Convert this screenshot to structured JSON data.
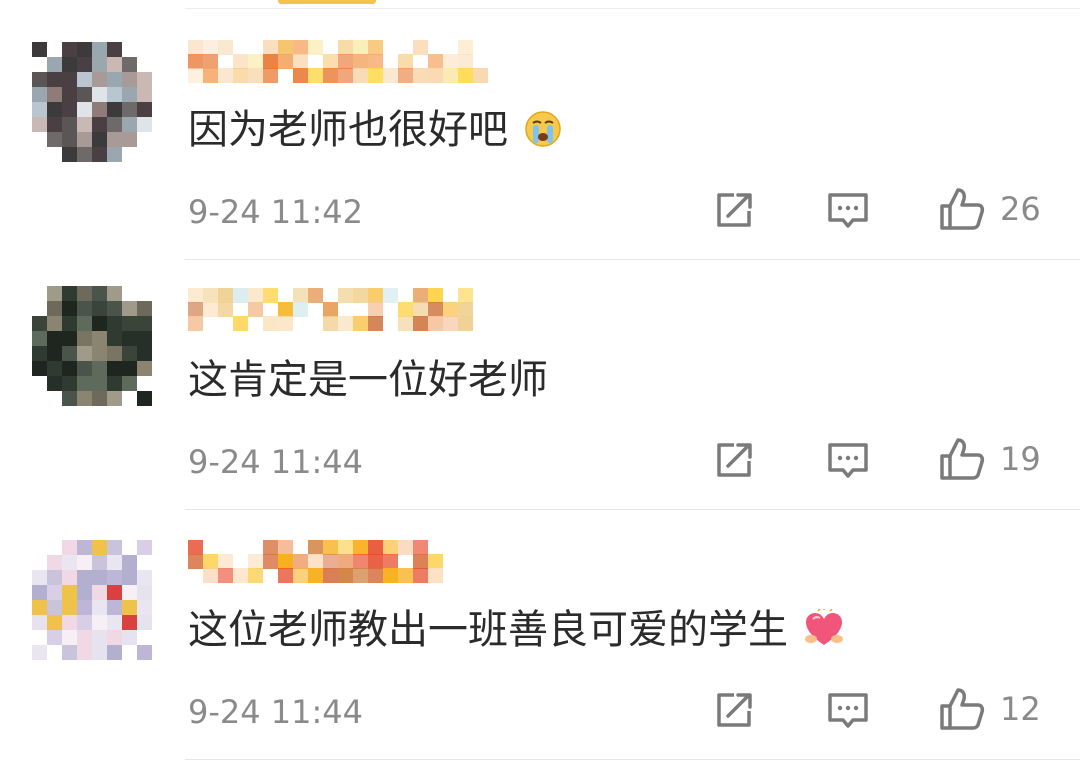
{
  "colors": {
    "text": "#2b2b2b",
    "meta": "#8a8a8a",
    "icon": "#7a7a7a",
    "divider": "#e6e6e6"
  },
  "comments": [
    {
      "text": "因为老师也很好吧",
      "emoji": "crying-face-emoji",
      "time": "9-24 11:42",
      "likes": "26"
    },
    {
      "text": "这肯定是一位好老师",
      "emoji": "",
      "time": "9-24 11:44",
      "likes": "19"
    },
    {
      "text": "这位老师教出一班善良可爱的学生",
      "emoji": "heart-hands-emoji",
      "time": "9-24 11:44",
      "likes": "12"
    }
  ],
  "icons": {
    "share": "share-icon",
    "reply": "comment-icon",
    "like": "thumbs-up-icon"
  }
}
